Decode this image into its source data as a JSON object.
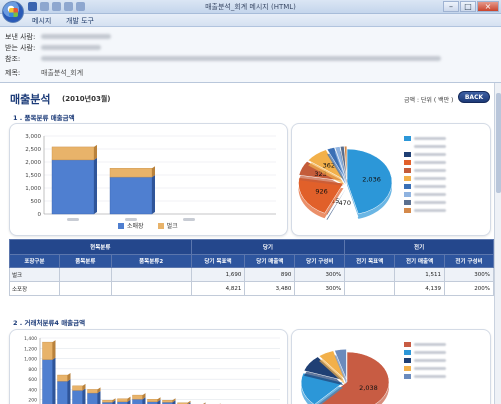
{
  "window": {
    "title": "매출분석_회계 메시지 (HTML)"
  },
  "ribbon": {
    "tabs": [
      "메시지",
      "개발 도구"
    ]
  },
  "header": {
    "from_label": "보낸 사람:",
    "to_label": "받는 사람:",
    "cc_label": "참조:",
    "subject_label": "제목:",
    "subject_value": "매출분석_회계"
  },
  "report": {
    "title": "매출분석",
    "period": "(2010년03월)",
    "unit": "금액 : 단위 ( 백만 )",
    "back_button": "BACK",
    "section1": "1 . 품목분류   매출금액",
    "section2": "2 . 거래처분류4   매출금액"
  },
  "chart1": {
    "legend": [
      "소매장",
      "벌크"
    ]
  },
  "pie1": {
    "labels": [
      "2,036",
      "470",
      "15",
      "926",
      "323",
      "362"
    ]
  },
  "pie2": {
    "labels": [
      "2,038"
    ]
  },
  "table": {
    "group_header": "현목분류",
    "period_current": "당기",
    "period_previous": "전기",
    "columns": [
      "포장구분",
      "품목분류",
      "품목분류2",
      "당기 목표액",
      "당기 매출액",
      "당기 구성비",
      "전기 목표액",
      "전기 매출액",
      "전기 구성비"
    ],
    "rows": [
      [
        "벌크",
        "",
        "",
        "1,690",
        "890",
        "300%",
        "",
        "1,511",
        "300%"
      ],
      [
        "소포장",
        "",
        "",
        "4,821",
        "3,480",
        "300%",
        "",
        "4,139",
        "200%"
      ]
    ]
  },
  "colors": {
    "accent": "#24478c",
    "series1": "#4f7fd0",
    "series2": "#e8b36a"
  },
  "chart_data": [
    {
      "type": "bar",
      "categories": [
        "",
        "",
        ""
      ],
      "series": [
        {
          "name": "소매장",
          "values": [
            2080,
            1420,
            0
          ]
        },
        {
          "name": "벌크",
          "values": [
            500,
            340,
            0
          ]
        }
      ],
      "ylim": [
        0,
        3000
      ],
      "yticks": [
        "0",
        "500",
        "1,000",
        "1,500",
        "2,000",
        "2,500",
        "3,000"
      ],
      "legend": "bottom"
    },
    {
      "type": "pie",
      "values": [
        2036,
        470,
        15,
        926,
        323,
        362,
        120,
        80,
        60,
        40
      ],
      "labels": [
        "2,036",
        "470",
        "15",
        "926",
        "323",
        "362",
        "",
        "",
        "",
        ""
      ],
      "colors": [
        "#2c97d8",
        "#ffffff",
        "#1f3f74",
        "#e1602a",
        "#c45c3a",
        "#f2b04a",
        "#3a6fb5",
        "#8fb3e0",
        "#5a6f8f",
        "#d4894a"
      ],
      "legend": "right"
    },
    {
      "type": "bar",
      "categories": [
        "",
        "",
        "",
        "",
        "",
        "",
        "",
        "",
        "",
        "",
        "",
        "",
        "",
        "",
        "",
        ""
      ],
      "series": [
        {
          "name": "",
          "values": [
            980,
            560,
            380,
            330,
            150,
            160,
            210,
            160,
            150,
            110,
            90,
            70,
            60,
            40,
            30,
            20
          ]
        },
        {
          "name": "",
          "values": [
            340,
            120,
            90,
            70,
            40,
            60,
            80,
            50,
            40,
            30,
            20,
            20,
            10,
            10,
            10,
            5
          ]
        }
      ],
      "ylim": [
        0,
        1400
      ],
      "yticks": [
        "0",
        "200",
        "400",
        "600",
        "800",
        "1,000",
        "1,200",
        "1,400"
      ]
    },
    {
      "type": "pie",
      "values": [
        2038,
        600,
        300,
        200,
        150
      ],
      "labels": [
        "2,038",
        "",
        "",
        "",
        ""
      ],
      "colors": [
        "#c85c43",
        "#2c97d8",
        "#1f3f74",
        "#f2b04a",
        "#6b8bbd"
      ],
      "legend": "right"
    }
  ]
}
